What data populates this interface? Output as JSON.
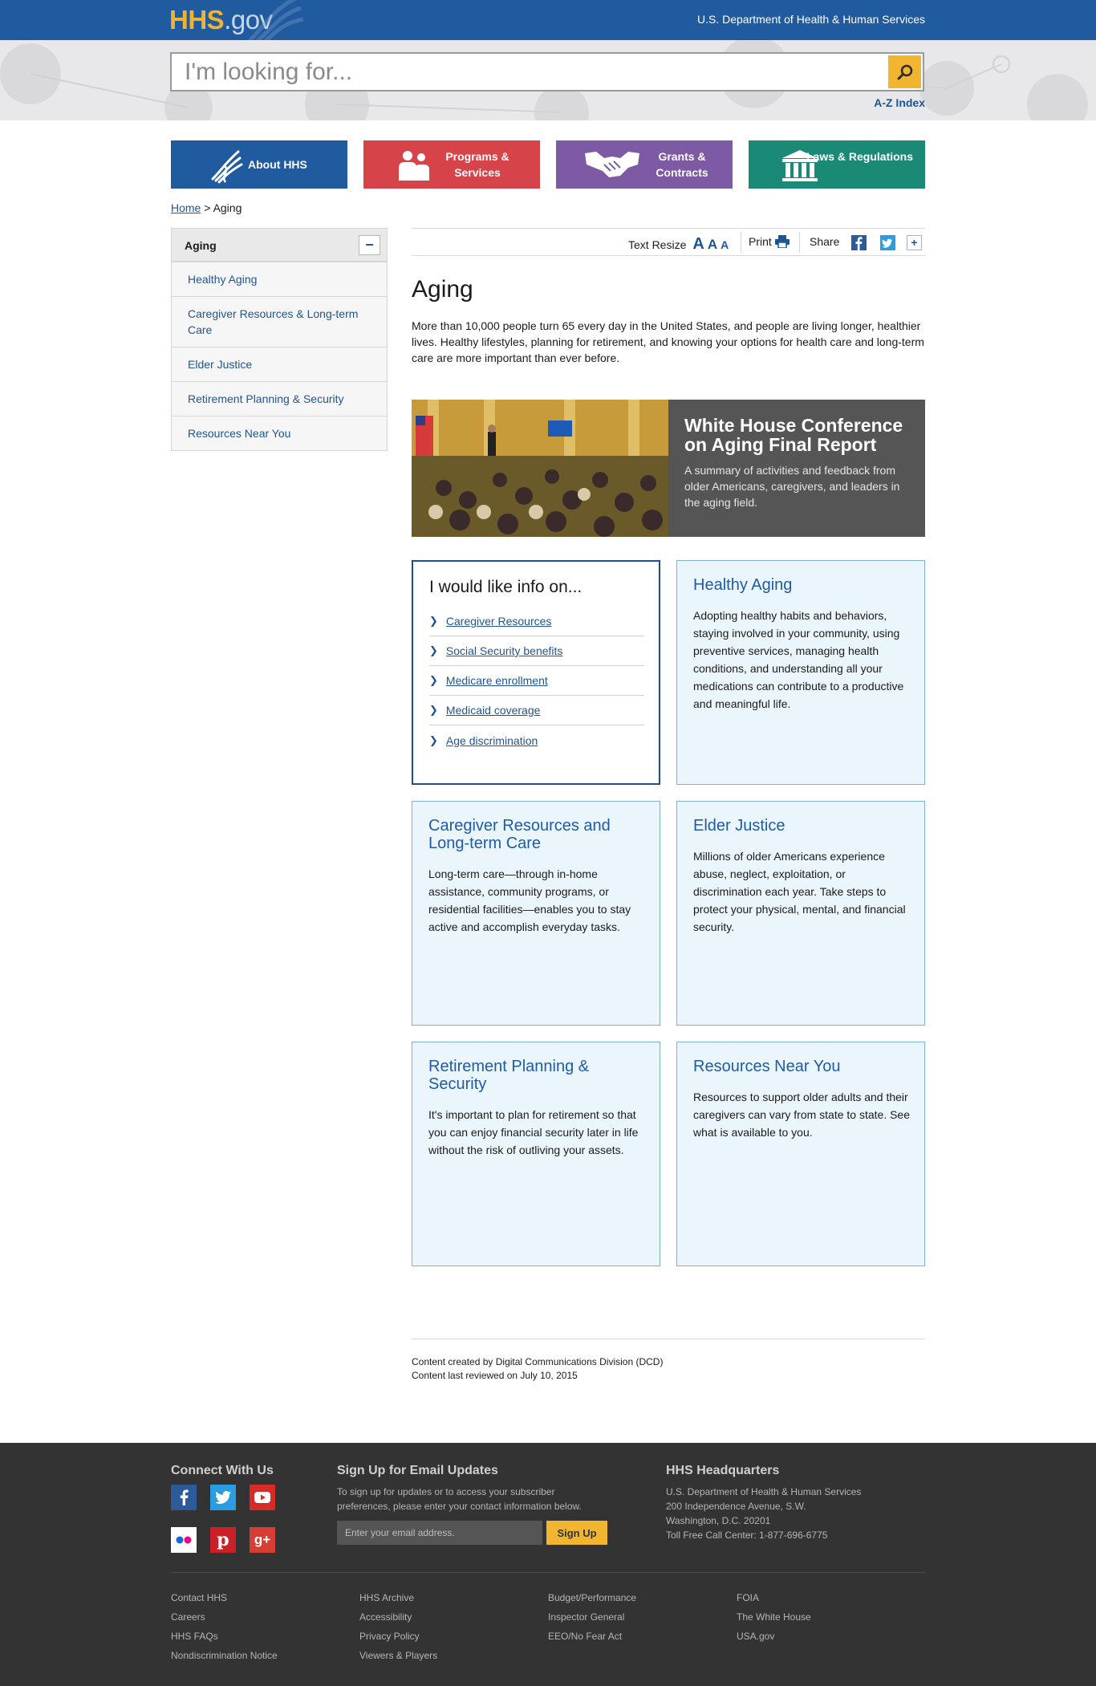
{
  "header": {
    "logo_main": "HHS",
    "logo_suffix": ".gov",
    "department": "U.S. Department of Health & Human Services",
    "brand_blue": "#1f5b9e",
    "brand_gold": "#f2b530"
  },
  "search": {
    "placeholder": "I'm looking for...",
    "button_icon": "search-icon",
    "az_index": "A-Z Index"
  },
  "nav": {
    "tiles": [
      {
        "label": "About HHS",
        "icon": "caduceus-icon",
        "color": "#1f5b9e"
      },
      {
        "label": "Programs & Services",
        "icon": "people-icon",
        "color": "#d64449"
      },
      {
        "label": "Grants & Contracts",
        "icon": "handshake-icon",
        "color": "#7d5aa3"
      },
      {
        "label": "Laws & Regulations",
        "icon": "building-icon",
        "color": "#1a8a76"
      }
    ]
  },
  "breadcrumb": {
    "home": "Home",
    "separator": ">",
    "current": "Aging"
  },
  "sidebar": {
    "title": "Aging",
    "toggle": "−",
    "items": [
      {
        "label": "Healthy Aging"
      },
      {
        "label": "Caregiver Resources & Long-term Care"
      },
      {
        "label": "Elder Justice"
      },
      {
        "label": "Retirement Planning & Security"
      },
      {
        "label": "Resources Near You"
      }
    ]
  },
  "tools": {
    "text_resize": "Text Resize",
    "resize_small": "A",
    "resize_medium": "A",
    "resize_large": "A",
    "print": "Print",
    "share": "Share",
    "more": "+"
  },
  "main": {
    "title": "Aging",
    "intro": "More than 10,000 people turn 65 every day in the United States, and people are living longer, healthier lives. Healthy lifestyles, planning for retirement, and knowing your options for health care and long-term care are more important than ever before.",
    "feature": {
      "title": "White House Conference on Aging Final Report",
      "description": "A summary of activities and feedback from older Americans, caregivers, and leaders in the aging field."
    },
    "info": {
      "heading": "I would like info on...",
      "links": [
        {
          "label": "Caregiver Resources"
        },
        {
          "label": "Social Security benefits"
        },
        {
          "label": "Medicare enrollment"
        },
        {
          "label": "Medicaid coverage"
        },
        {
          "label": "Age discrimination"
        }
      ]
    },
    "cards": [
      {
        "title": "Healthy Aging",
        "text": "Adopting healthy habits and behaviors, staying involved in your community, using preventive services, managing health conditions, and understanding all your medications can contribute to a productive and meaningful life."
      },
      {
        "title": "Caregiver Resources and Long-term Care",
        "text": "Long-term care—through in-home assistance, community programs, or residential facilities—enables you to stay active and accomplish everyday tasks."
      },
      {
        "title": "Elder Justice",
        "text": "Millions of older Americans experience abuse, neglect, exploitation, or discrimination each year. Take steps to protect your physical, mental, and financial security."
      },
      {
        "title": "Retirement Planning & Security",
        "text": "It's important to plan for retirement so that you can enjoy financial security later in life without the risk of outliving your assets."
      },
      {
        "title": "Resources Near You",
        "text": "Resources to support older adults and their caregivers can vary from state to state. See what is available to you."
      }
    ],
    "meta": {
      "created": "Content created by Digital Communications Division (DCD)",
      "reviewed": "Content last reviewed on July 10, 2015"
    }
  },
  "footer": {
    "connect_title": "Connect With Us",
    "social": [
      "facebook-icon",
      "twitter-icon",
      "youtube-icon",
      "flickr-icon",
      "pinterest-icon",
      "google-plus-icon"
    ],
    "signup_title": "Sign Up for Email Updates",
    "signup_text": "To sign up for updates or to access your subscriber preferences, please enter your contact information below.",
    "email_placeholder": "Enter your email address.",
    "signup_button": "Sign Up",
    "hq_title": "HHS Headquarters",
    "hq_lines": [
      "U.S. Department of Health & Human Services",
      "200 Independence Avenue, S.W.",
      "Washington, D.C. 20201",
      "Toll Free Call Center: 1-877-696-6775"
    ],
    "link_columns": [
      [
        "Contact HHS",
        "Careers",
        "HHS FAQs",
        "Nondiscrimination Notice"
      ],
      [
        "HHS Archive",
        "Accessibility",
        "Privacy Policy",
        "Viewers & Players"
      ],
      [
        "Budget/Performance",
        "Inspector General",
        "EEO/No Fear Act"
      ],
      [
        "FOIA",
        "The White House",
        "USA.gov"
      ]
    ]
  }
}
